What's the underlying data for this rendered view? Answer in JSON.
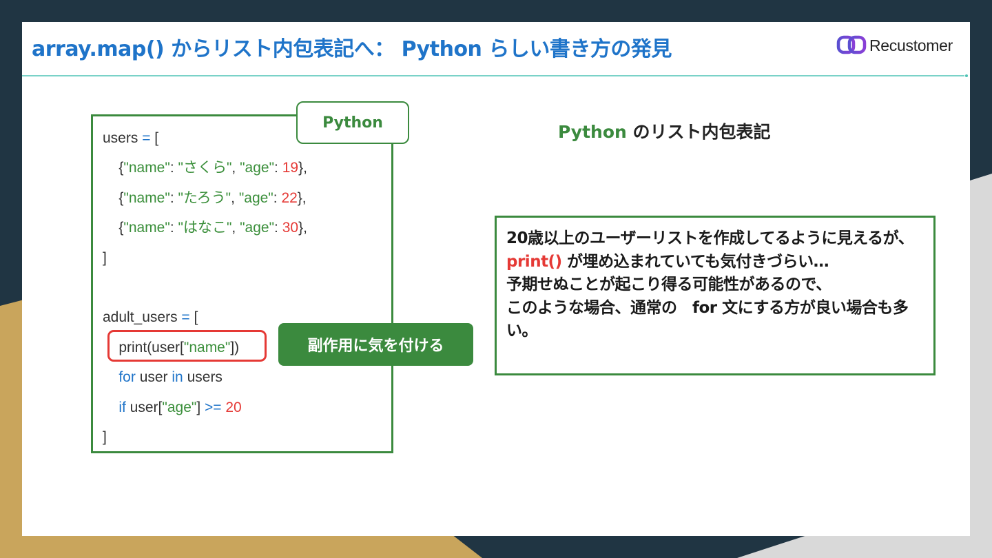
{
  "slide": {
    "title": "array.map() からリスト内包表記へ： Python らしい書き方の発見",
    "logo_text": "Recustomer"
  },
  "code_panel": {
    "tag": "Python",
    "lines": [
      [
        {
          "t": "users ",
          "c": "p"
        },
        {
          "t": "=",
          "c": "k"
        },
        {
          "t": " [",
          "c": "p"
        }
      ],
      [
        {
          "t": "    {",
          "c": "p"
        },
        {
          "t": "\"name\"",
          "c": "s"
        },
        {
          "t": ": ",
          "c": "p"
        },
        {
          "t": "\"さくら\"",
          "c": "s"
        },
        {
          "t": ", ",
          "c": "p"
        },
        {
          "t": "\"age\"",
          "c": "s"
        },
        {
          "t": ": ",
          "c": "p"
        },
        {
          "t": "19",
          "c": "n"
        },
        {
          "t": "},",
          "c": "p"
        }
      ],
      [
        {
          "t": "    {",
          "c": "p"
        },
        {
          "t": "\"name\"",
          "c": "s"
        },
        {
          "t": ": ",
          "c": "p"
        },
        {
          "t": "\"たろう\"",
          "c": "s"
        },
        {
          "t": ", ",
          "c": "p"
        },
        {
          "t": "\"age\"",
          "c": "s"
        },
        {
          "t": ": ",
          "c": "p"
        },
        {
          "t": "22",
          "c": "n"
        },
        {
          "t": "},",
          "c": "p"
        }
      ],
      [
        {
          "t": "    {",
          "c": "p"
        },
        {
          "t": "\"name\"",
          "c": "s"
        },
        {
          "t": ": ",
          "c": "p"
        },
        {
          "t": "\"はなこ\"",
          "c": "s"
        },
        {
          "t": ", ",
          "c": "p"
        },
        {
          "t": "\"age\"",
          "c": "s"
        },
        {
          "t": ": ",
          "c": "p"
        },
        {
          "t": "30",
          "c": "n"
        },
        {
          "t": "},",
          "c": "p"
        }
      ],
      [
        {
          "t": "]",
          "c": "p"
        }
      ],
      [],
      [
        {
          "t": "adult_users ",
          "c": "p"
        },
        {
          "t": "=",
          "c": "k"
        },
        {
          "t": " [",
          "c": "p"
        }
      ],
      [
        {
          "t": "    print(user[",
          "c": "p"
        },
        {
          "t": "\"name\"",
          "c": "s"
        },
        {
          "t": "])",
          "c": "p"
        }
      ],
      [
        {
          "t": "    ",
          "c": "p"
        },
        {
          "t": "for",
          "c": "k"
        },
        {
          "t": " user ",
          "c": "p"
        },
        {
          "t": "in",
          "c": "k"
        },
        {
          "t": " users",
          "c": "p"
        }
      ],
      [
        {
          "t": "    ",
          "c": "p"
        },
        {
          "t": "if",
          "c": "k"
        },
        {
          "t": " user[",
          "c": "p"
        },
        {
          "t": "\"age\"",
          "c": "s"
        },
        {
          "t": "] ",
          "c": "p"
        },
        {
          "t": ">=",
          "c": "k"
        },
        {
          "t": " ",
          "c": "p"
        },
        {
          "t": "20",
          "c": "n"
        }
      ],
      [
        {
          "t": "]",
          "c": "p"
        }
      ]
    ],
    "callout": "副作用に気を付ける"
  },
  "explanation": {
    "title_python": "Python",
    "title_rest": " のリスト内包表記",
    "note_part1": "20歳以上のユーザーリストを作成してるように見えるが、 ",
    "note_code": "print()",
    "note_part2": " が埋め込まれていても気付きづらい…",
    "note_line2": "予期せぬことが起こり得る可能性があるので、",
    "note_line3": "このような場合、通常の　for 文にする方が良い場合も多い。"
  },
  "colors": {
    "accent_blue": "#1f74c9",
    "accent_green": "#3b8a3e",
    "alert_red": "#e53935",
    "teal_rule": "#4fc3b5",
    "bg_navy": "#203543",
    "bg_gold": "#c9a55c"
  }
}
